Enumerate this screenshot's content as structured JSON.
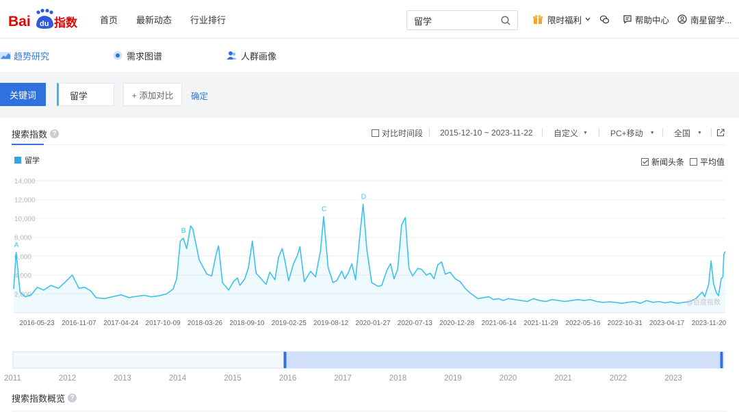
{
  "header": {
    "logo": "Baidu指数",
    "nav": [
      "首页",
      "最新动态",
      "行业排行"
    ],
    "search": {
      "value": "留学",
      "placeholder": ""
    },
    "gift_label": "限时福利",
    "help_label": "帮助中心",
    "user_label": "南星留学..."
  },
  "tabs": [
    {
      "label": "趋势研究",
      "active": true
    },
    {
      "label": "需求图谱",
      "active": false
    },
    {
      "label": "人群画像",
      "active": false
    }
  ],
  "keywords": {
    "label_button": "关键词",
    "keyword": "留学",
    "add_compare": "+ 添加对比",
    "confirm": "确定"
  },
  "panel": {
    "title": "搜索指数",
    "help": "?",
    "compare_period": "对比时间段",
    "date_range": "2015-12-10 ~ 2023-11-22",
    "custom": "自定义",
    "device": "PC+移动",
    "region": "全国",
    "legend_label": "留学",
    "option_news": "新闻头条",
    "option_avg": "平均值",
    "overview_title": "搜索指数概览"
  },
  "chart_data": {
    "type": "area",
    "series_name": "留学",
    "color": "#39c2ec",
    "ylim": [
      0,
      14000
    ],
    "y_ticks": [
      "2,000",
      "4,000",
      "6,000",
      "8,000",
      "10,000",
      "12,000",
      "14,000"
    ],
    "x_ticks": [
      "2016-05-23",
      "2016-11-07",
      "2017-04-24",
      "2017-10-09",
      "2018-03-26",
      "2018-09-10",
      "2019-02-25",
      "2019-08-12",
      "2020-01-27",
      "2020-07-13",
      "2020-12-28",
      "2021-06-14",
      "2021-11-29",
      "2022-05-16",
      "2022-10-31",
      "2023-04-17",
      "2023-11-20"
    ],
    "points": [
      [
        "2015-12-10",
        2500
      ],
      [
        "2015-12-20",
        6400
      ],
      [
        "2016-01-05",
        2200
      ],
      [
        "2016-01-25",
        1700
      ],
      [
        "2016-02-20",
        1900
      ],
      [
        "2016-03-15",
        2700
      ],
      [
        "2016-04-10",
        2400
      ],
      [
        "2016-05-10",
        2900
      ],
      [
        "2016-06-10",
        2600
      ],
      [
        "2016-07-05",
        3200
      ],
      [
        "2016-08-05",
        4000
      ],
      [
        "2016-09-01",
        2600
      ],
      [
        "2016-09-25",
        2700
      ],
      [
        "2016-10-20",
        2300
      ],
      [
        "2016-11-10",
        1600
      ],
      [
        "2016-12-15",
        1500
      ],
      [
        "2017-01-15",
        1700
      ],
      [
        "2017-02-20",
        1900
      ],
      [
        "2017-03-25",
        1600
      ],
      [
        "2017-04-25",
        1750
      ],
      [
        "2017-05-25",
        1850
      ],
      [
        "2017-06-25",
        1700
      ],
      [
        "2017-07-25",
        1800
      ],
      [
        "2017-08-25",
        2000
      ],
      [
        "2017-09-20",
        2500
      ],
      [
        "2017-10-05",
        3600
      ],
      [
        "2017-10-20",
        7600
      ],
      [
        "2017-11-01",
        7900
      ],
      [
        "2017-11-15",
        6800
      ],
      [
        "2017-12-01",
        9200
      ],
      [
        "2017-12-10",
        8900
      ],
      [
        "2018-01-05",
        5600
      ],
      [
        "2018-02-05",
        4100
      ],
      [
        "2018-02-25",
        3900
      ],
      [
        "2018-03-15",
        6200
      ],
      [
        "2018-03-25",
        7100
      ],
      [
        "2018-04-10",
        3200
      ],
      [
        "2018-05-05",
        2400
      ],
      [
        "2018-05-25",
        3300
      ],
      [
        "2018-06-10",
        3700
      ],
      [
        "2018-06-20",
        2900
      ],
      [
        "2018-07-10",
        3600
      ],
      [
        "2018-07-25",
        4800
      ],
      [
        "2018-08-10",
        7600
      ],
      [
        "2018-08-25",
        4200
      ],
      [
        "2018-09-15",
        3600
      ],
      [
        "2018-10-05",
        3000
      ],
      [
        "2018-10-20",
        4300
      ],
      [
        "2018-11-10",
        3500
      ],
      [
        "2018-11-25",
        5900
      ],
      [
        "2018-12-10",
        6800
      ],
      [
        "2018-12-20",
        5600
      ],
      [
        "2019-01-05",
        3400
      ],
      [
        "2019-01-25",
        5200
      ],
      [
        "2019-02-10",
        6100
      ],
      [
        "2019-02-20",
        7000
      ],
      [
        "2019-03-10",
        3300
      ],
      [
        "2019-04-05",
        4400
      ],
      [
        "2019-04-25",
        3800
      ],
      [
        "2019-05-15",
        6600
      ],
      [
        "2019-05-28",
        10200
      ],
      [
        "2019-06-15",
        4800
      ],
      [
        "2019-07-05",
        3200
      ],
      [
        "2019-07-20",
        3400
      ],
      [
        "2019-08-10",
        4400
      ],
      [
        "2019-08-22",
        3600
      ],
      [
        "2019-09-05",
        4200
      ],
      [
        "2019-09-20",
        5200
      ],
      [
        "2019-10-05",
        3500
      ],
      [
        "2019-10-25",
        8800
      ],
      [
        "2019-11-05",
        11500
      ],
      [
        "2019-11-20",
        6700
      ],
      [
        "2019-12-10",
        3200
      ],
      [
        "2020-01-05",
        2800
      ],
      [
        "2020-01-20",
        2900
      ],
      [
        "2020-02-10",
        4500
      ],
      [
        "2020-02-25",
        5200
      ],
      [
        "2020-03-10",
        3600
      ],
      [
        "2020-03-25",
        4600
      ],
      [
        "2020-04-10",
        9300
      ],
      [
        "2020-04-25",
        10100
      ],
      [
        "2020-05-10",
        4700
      ],
      [
        "2020-05-25",
        3900
      ],
      [
        "2020-06-15",
        4700
      ],
      [
        "2020-07-01",
        4600
      ],
      [
        "2020-07-20",
        4000
      ],
      [
        "2020-08-05",
        4200
      ],
      [
        "2020-08-20",
        3600
      ],
      [
        "2020-09-05",
        5100
      ],
      [
        "2020-09-20",
        5400
      ],
      [
        "2020-10-05",
        4100
      ],
      [
        "2020-10-25",
        4300
      ],
      [
        "2020-11-15",
        3600
      ],
      [
        "2020-12-05",
        3300
      ],
      [
        "2020-12-25",
        2600
      ],
      [
        "2021-01-10",
        2200
      ],
      [
        "2021-01-25",
        1900
      ],
      [
        "2021-02-15",
        1500
      ],
      [
        "2021-03-10",
        1600
      ],
      [
        "2021-04-01",
        1700
      ],
      [
        "2021-04-20",
        1400
      ],
      [
        "2021-05-10",
        1500
      ],
      [
        "2021-05-30",
        1300
      ],
      [
        "2021-06-20",
        1500
      ],
      [
        "2021-07-15",
        1400
      ],
      [
        "2021-08-10",
        1300
      ],
      [
        "2021-09-05",
        1200
      ],
      [
        "2021-09-30",
        1500
      ],
      [
        "2021-10-25",
        1300
      ],
      [
        "2021-11-20",
        1200
      ],
      [
        "2021-12-15",
        1400
      ],
      [
        "2022-01-10",
        1300
      ],
      [
        "2022-02-05",
        1200
      ],
      [
        "2022-03-05",
        1300
      ],
      [
        "2022-04-01",
        1400
      ],
      [
        "2022-04-25",
        1300
      ],
      [
        "2022-05-20",
        1400
      ],
      [
        "2022-06-15",
        1200
      ],
      [
        "2022-07-10",
        1100
      ],
      [
        "2022-08-05",
        1150
      ],
      [
        "2022-09-01",
        1100
      ],
      [
        "2022-09-25",
        1000
      ],
      [
        "2022-10-20",
        1100
      ],
      [
        "2022-11-15",
        1200
      ],
      [
        "2022-12-10",
        1000
      ],
      [
        "2023-01-05",
        1300
      ],
      [
        "2023-02-01",
        1100
      ],
      [
        "2023-02-25",
        1200
      ],
      [
        "2023-03-20",
        1050
      ],
      [
        "2023-04-15",
        1150
      ],
      [
        "2023-05-10",
        1000
      ],
      [
        "2023-06-05",
        1100
      ],
      [
        "2023-07-01",
        1200
      ],
      [
        "2023-07-25",
        1500
      ],
      [
        "2023-08-20",
        2200
      ],
      [
        "2023-08-30",
        1700
      ],
      [
        "2023-09-15",
        3000
      ],
      [
        "2023-09-25",
        5500
      ],
      [
        "2023-10-05",
        3100
      ],
      [
        "2023-10-15",
        2200
      ],
      [
        "2023-10-25",
        1800
      ],
      [
        "2023-11-05",
        3600
      ],
      [
        "2023-11-12",
        3800
      ],
      [
        "2023-11-16",
        6200
      ],
      [
        "2023-11-22",
        6500
      ]
    ],
    "annotations": [
      {
        "label": "A",
        "x": "2015-12-20"
      },
      {
        "label": "B",
        "x": "2017-11-01"
      },
      {
        "label": "C",
        "x": "2019-05-28"
      },
      {
        "label": "D",
        "x": "2019-11-05"
      }
    ],
    "watermark": "@百度指数",
    "navigator_years": [
      "2011",
      "2012",
      "2013",
      "2014",
      "2015",
      "2016",
      "2017",
      "2018",
      "2019",
      "2020",
      "2021",
      "2022",
      "2023"
    ]
  }
}
